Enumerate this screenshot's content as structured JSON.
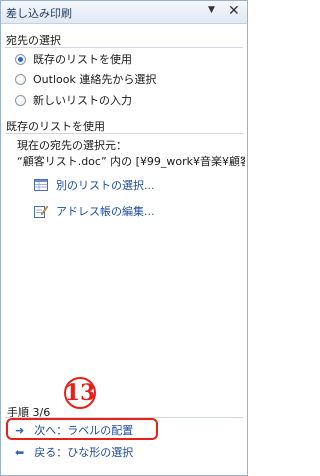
{
  "pane": {
    "title": "差し込み印刷",
    "dropdown_icon": "▼",
    "close_icon": "✕"
  },
  "destination": {
    "heading": "宛先の選択",
    "options": [
      {
        "label": "既存のリストを使用",
        "selected": true
      },
      {
        "label": "Outlook 連絡先から選択",
        "selected": false
      },
      {
        "label": "新しいリストの入力",
        "selected": false
      }
    ]
  },
  "existing": {
    "heading": "既存のリストを使用",
    "current_label": "現在の宛先の選択元：",
    "source_line": "“顧客リスト.doc” 内の [¥99_work¥音楽¥顧客リ",
    "links": [
      {
        "label": "別のリストの選択...",
        "icon": "list-icon"
      },
      {
        "label": "アドレス帳の編集...",
        "icon": "edit-pencil-icon"
      }
    ]
  },
  "footer": {
    "step": "手順 3/6",
    "annotation": "13",
    "next": "次へ：ラベルの配置",
    "back": "戻る：ひな形の選択"
  },
  "colors": {
    "accent": "#1f4fa0",
    "annotation": "#e8201a",
    "title_text": "#1e395b"
  }
}
